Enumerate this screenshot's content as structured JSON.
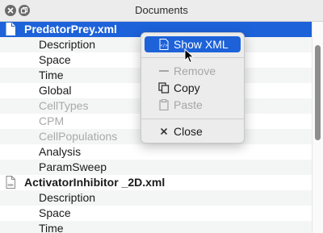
{
  "window": {
    "title": "Documents"
  },
  "tree": {
    "files": [
      {
        "name": "PredatorPrey.xml",
        "children": [
          {
            "label": "Description",
            "disabled": false
          },
          {
            "label": "Space",
            "disabled": false
          },
          {
            "label": "Time",
            "disabled": false
          },
          {
            "label": "Global",
            "disabled": false
          },
          {
            "label": "CellTypes",
            "disabled": true
          },
          {
            "label": "CPM",
            "disabled": true
          },
          {
            "label": "CellPopulations",
            "disabled": true
          },
          {
            "label": "Analysis",
            "disabled": false
          },
          {
            "label": "ParamSweep",
            "disabled": false
          }
        ]
      },
      {
        "name": "ActivatorInhibitor _2D.xml",
        "children": [
          {
            "label": "Description",
            "disabled": false
          },
          {
            "label": "Space",
            "disabled": false
          },
          {
            "label": "Time",
            "disabled": false
          }
        ]
      }
    ]
  },
  "context_menu": {
    "items": [
      {
        "label": "Show XML",
        "icon": "xml-icon",
        "state": "highlighted"
      },
      {
        "label": "Remove",
        "icon": "minus-icon",
        "state": "disabled"
      },
      {
        "label": "Copy",
        "icon": "copy-icon",
        "state": "enabled"
      },
      {
        "label": "Paste",
        "icon": "paste-icon",
        "state": "disabled"
      },
      {
        "label": "Close",
        "icon": "close-x-icon",
        "state": "enabled"
      }
    ]
  },
  "colors": {
    "selection": "#1d62d9",
    "disabled_text": "#a9a9a9"
  }
}
